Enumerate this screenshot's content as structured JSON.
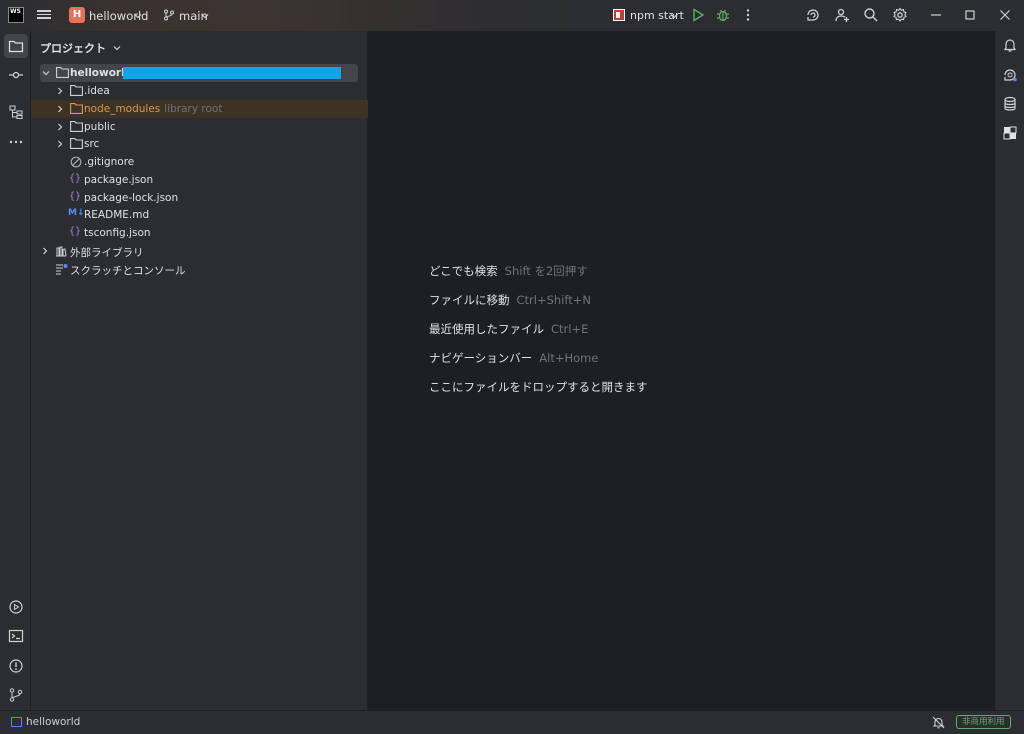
{
  "titlebar": {
    "logo_text": "WS",
    "project_badge": "H",
    "project_name": "helloworld",
    "branch": "main",
    "run_config": "npm start"
  },
  "project_panel": {
    "title": "プロジェクト",
    "tree": [
      {
        "label": "helloworld",
        "kind": "folder",
        "expanded": true,
        "level": 0
      },
      {
        "label": ".idea",
        "kind": "folder",
        "level": 1
      },
      {
        "label": "node_modules",
        "hint": "library root",
        "kind": "folder-excluded",
        "level": 1
      },
      {
        "label": "public",
        "kind": "folder",
        "level": 1
      },
      {
        "label": "src",
        "kind": "folder",
        "level": 1
      },
      {
        "label": ".gitignore",
        "kind": "ignore",
        "level": 1
      },
      {
        "label": "package.json",
        "kind": "json",
        "level": 1
      },
      {
        "label": "package-lock.json",
        "kind": "json",
        "level": 1
      },
      {
        "label": "README.md",
        "kind": "md",
        "level": 1
      },
      {
        "label": "tsconfig.json",
        "kind": "json",
        "level": 1
      },
      {
        "label": "外部ライブラリ",
        "kind": "libraries",
        "level": 0
      },
      {
        "label": "スクラッチとコンソール",
        "kind": "scratches",
        "level": 0
      }
    ]
  },
  "editor_hints": [
    {
      "action": "どこでも検索",
      "shortcut": "Shift を2回押す"
    },
    {
      "action": "ファイルに移動",
      "shortcut": "Ctrl+Shift+N"
    },
    {
      "action": "最近使用したファイル",
      "shortcut": "Ctrl+E"
    },
    {
      "action": "ナビゲーションバー",
      "shortcut": "Alt+Home"
    },
    {
      "action": "ここにファイルをドロップすると開きます",
      "shortcut": ""
    }
  ],
  "statusbar": {
    "project": "helloworld",
    "badge": "非商用利用"
  },
  "colors": {
    "accent": "#548af7",
    "project_badge": "#e5735a",
    "run": "#5fad65",
    "editor_bg": "#1e1f22",
    "panel_bg": "#2b2d30"
  }
}
